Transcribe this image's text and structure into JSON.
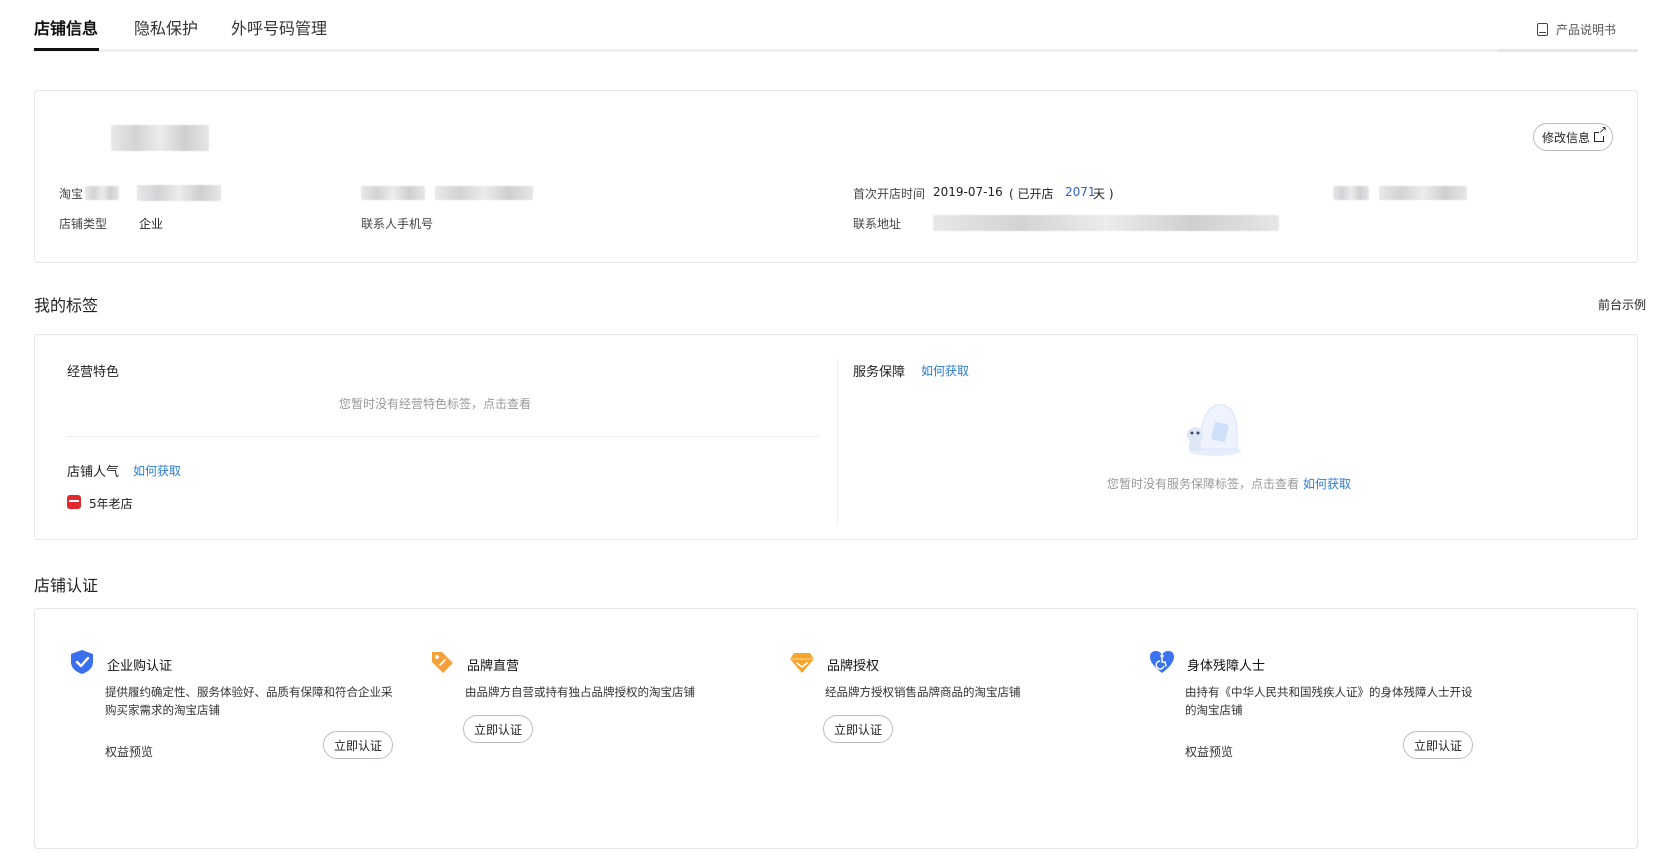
{
  "tabs": [
    {
      "label": "店铺信息",
      "active": true
    },
    {
      "label": "隐私保护",
      "active": false
    },
    {
      "label": "外呼号码管理",
      "active": false
    }
  ],
  "manual_label": "产品说明书",
  "shop_info": {
    "edit_label": "修改信息",
    "taobao_label": "淘宝",
    "shop_type_label": "店铺类型",
    "shop_type_value": "企业",
    "contact_phone_label": "联系人手机号",
    "open_time_label": "首次开店时间",
    "open_date": "2019-07-16",
    "open_days_prefix": "( 已开店",
    "open_days": "2071",
    "open_days_suffix": "天 )",
    "address_label": "联系地址"
  },
  "tags_section": {
    "title": "我的标签",
    "preview_link": "前台示例",
    "business_features_title": "经营特色",
    "business_features_empty": "您暂时没有经营特色标签，点击查看",
    "popularity_title": "店铺人气",
    "how_to_get": "如何获取",
    "popularity_badge": "5年老店",
    "service_title": "服务保障",
    "service_empty": "您暂时没有服务保障标签，点击查看",
    "service_empty_link": "如何获取"
  },
  "cert_section": {
    "title": "店铺认证",
    "items": [
      {
        "title": "企业购认证",
        "desc": "提供履约确定性、服务体验好、品质有保障和符合企业采购买家需求的淘宝店铺",
        "benefit": "权益预览",
        "action": "立即认证",
        "icon": "shield-check-icon",
        "color": "#3b6ff0"
      },
      {
        "title": "品牌直营",
        "desc": "由品牌方自营或持有独占品牌授权的淘宝店铺",
        "benefit": "",
        "action": "立即认证",
        "icon": "tag-icon",
        "color": "#f5a03a"
      },
      {
        "title": "品牌授权",
        "desc": "经品牌方授权销售品牌商品的淘宝店铺",
        "benefit": "",
        "action": "立即认证",
        "icon": "diamond-icon",
        "color": "#f5a62a"
      },
      {
        "title": "身体残障人士",
        "desc": "由持有《中华人民共和国残疾人证》的身体残障人士开设的淘宝店铺",
        "benefit": "权益预览",
        "action": "立即认证",
        "icon": "heart-accessibility-icon",
        "color": "#3b73f0"
      }
    ]
  }
}
